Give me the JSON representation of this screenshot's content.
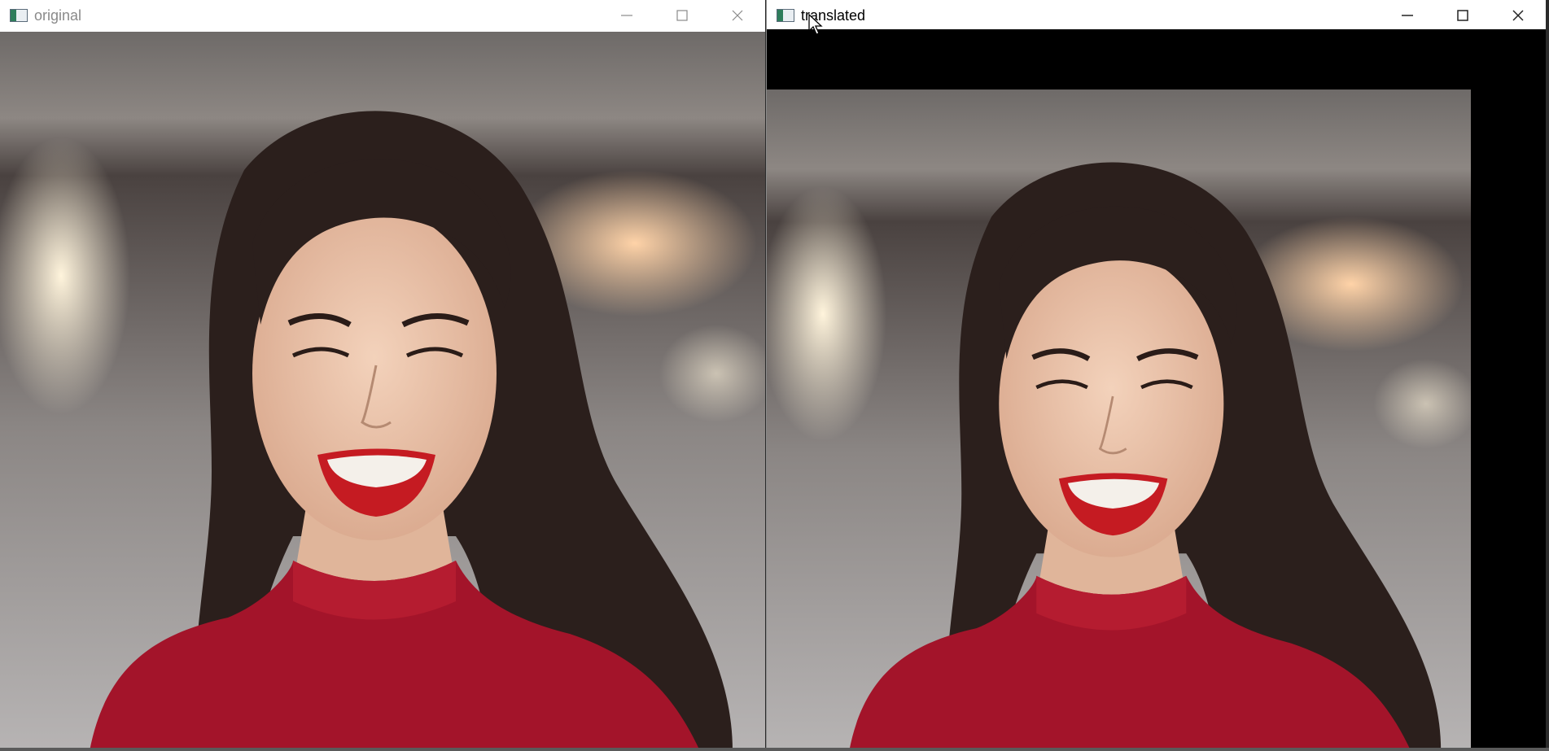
{
  "windows": {
    "original": {
      "title": "original",
      "icon": "opencv-window-icon",
      "buttons": [
        "minimize",
        "maximize",
        "close"
      ],
      "image_description_colors": {
        "background_top": "#6f6c6a",
        "background_mid": "#9a9593",
        "hair": "#2b1f1c",
        "skin": "#e8c0a4",
        "lips": "#c51b22",
        "sweater": "#a3142a"
      }
    },
    "translated": {
      "title": "translated",
      "icon": "opencv-window-icon",
      "buttons": [
        "minimize",
        "maximize",
        "close"
      ],
      "fill_color": "#000000"
    }
  }
}
